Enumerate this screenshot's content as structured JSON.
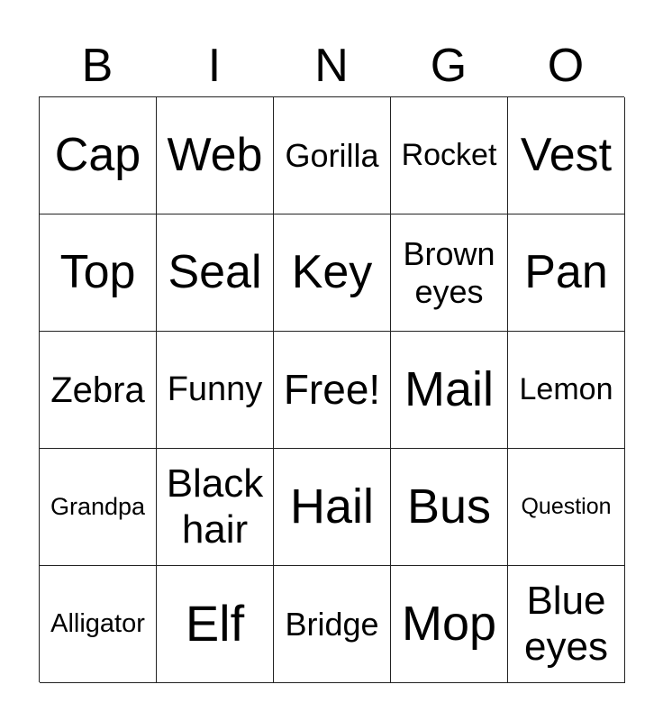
{
  "card": {
    "header": [
      "B",
      "I",
      "N",
      "G",
      "O"
    ],
    "rows": [
      [
        "Cap",
        "Web",
        "Gorilla",
        "Rocket",
        "Vest"
      ],
      [
        "Top",
        "Seal",
        "Key",
        "Brown eyes",
        "Pan"
      ],
      [
        "Zebra",
        "Funny",
        "Free!",
        "Mail",
        "Lemon"
      ],
      [
        "Grandpa",
        "Black hair",
        "Hail",
        "Bus",
        "Question"
      ],
      [
        "Alligator",
        "Elf",
        "Bridge",
        "Mop",
        "Blue eyes"
      ]
    ]
  }
}
